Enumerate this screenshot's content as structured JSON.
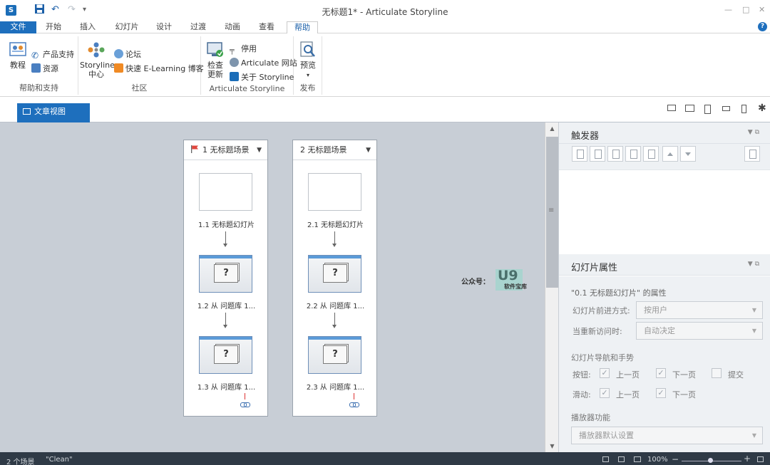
{
  "window": {
    "title": "无标题1* - Articulate Storyline",
    "logo": "S"
  },
  "quick_access": {
    "save": "save-icon",
    "undo": "↶",
    "redo": "↷",
    "customize": "▾"
  },
  "tabs": [
    "文件",
    "开始",
    "插入",
    "幻灯片",
    "设计",
    "过渡",
    "动画",
    "查看",
    "帮助"
  ],
  "active_tab": "帮助",
  "help_icon": "?",
  "ribbon": {
    "groups": [
      {
        "label": "帮助和支持",
        "items": [
          "教程",
          "产品支持",
          "资源"
        ]
      },
      {
        "label": "社区",
        "items": [
          "Storyline",
          "中心",
          "论坛",
          "快速 E-Learning 博客"
        ]
      },
      {
        "label": "Articulate Storyline",
        "items": [
          "检查",
          "更新",
          "停用",
          "Articulate 网站",
          "关于 Storyline"
        ]
      },
      {
        "label": "发布",
        "items": [
          "预览",
          "▾"
        ]
      }
    ]
  },
  "view_tab": "文章视图",
  "scenes": [
    {
      "title": "1 无标题场景",
      "starting": true,
      "slides": [
        "1.1 无标题幻灯片",
        "1.2 从 问题库 1...",
        "1.3 从 问题库 1..."
      ]
    },
    {
      "title": "2 无标题场景",
      "starting": false,
      "slides": [
        "2.1 无标题幻灯片",
        "2.2 从 问题库 1...",
        "2.3 从 问题库 1..."
      ]
    }
  ],
  "question_glyph": "?",
  "watermark": {
    "label": "公众号：",
    "logo": "U9",
    "sub": "软件宝库"
  },
  "triggers_panel": {
    "title": "触发器"
  },
  "properties_panel": {
    "title": "幻灯片属性",
    "subtitle": "\"0.1 无标题幻灯片\" 的属性",
    "advance_label": "幻灯片前进方式:",
    "advance_value": "按用户",
    "revisit_label": "当重新访问时:",
    "revisit_value": "自动决定",
    "nav_heading": "幻灯片导航和手势",
    "buttons_label": "按钮:",
    "prev": "上一页",
    "next": "下一页",
    "submit": "提交",
    "swipe_label": "滑动:",
    "player_heading": "播放器功能",
    "player_value": "播放器默认设置",
    "check": "✓"
  },
  "status": {
    "scenes": "2 个场景",
    "theme": "\"Clean\"",
    "zoom": "100%",
    "minus": "−",
    "plus": "+"
  }
}
